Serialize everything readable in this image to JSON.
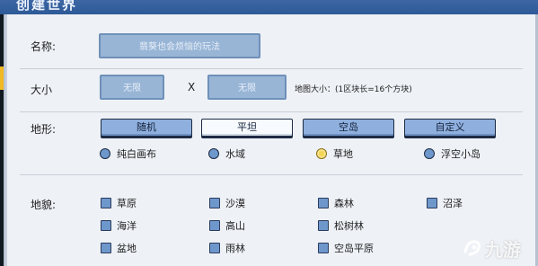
{
  "window": {
    "title": "创建世界"
  },
  "name_row": {
    "label": "名称:",
    "value": "翡葵也会烦恼的玩法"
  },
  "size_row": {
    "label": "大小",
    "width_value": "无限",
    "x_symbol": "X",
    "height_value": "无限",
    "hint": "地图大小：(1区块长=16个方块)"
  },
  "terrain_row": {
    "label": "地形:",
    "buttons": [
      "随机",
      "平坦",
      "空岛",
      "自定义"
    ],
    "selected": "平坦",
    "options": [
      {
        "label": "纯白画布",
        "checked": false
      },
      {
        "label": "水域",
        "checked": false
      },
      {
        "label": "草地",
        "checked": true
      },
      {
        "label": "浮空小岛",
        "checked": false
      }
    ]
  },
  "landform_row": {
    "label": "地貌:",
    "items": [
      "草原",
      "沙漠",
      "森林",
      "沼泽",
      "海洋",
      "高山",
      "松树林",
      "盆地",
      "雨林",
      "空岛平原"
    ]
  },
  "watermark": {
    "text": "九游"
  },
  "colors": {
    "titlebar": "#2e5a98",
    "panel": "#eef1f6",
    "button": "#8fb0de",
    "selected_button": "#f7fbff",
    "radio_checked": "#f3d455"
  }
}
